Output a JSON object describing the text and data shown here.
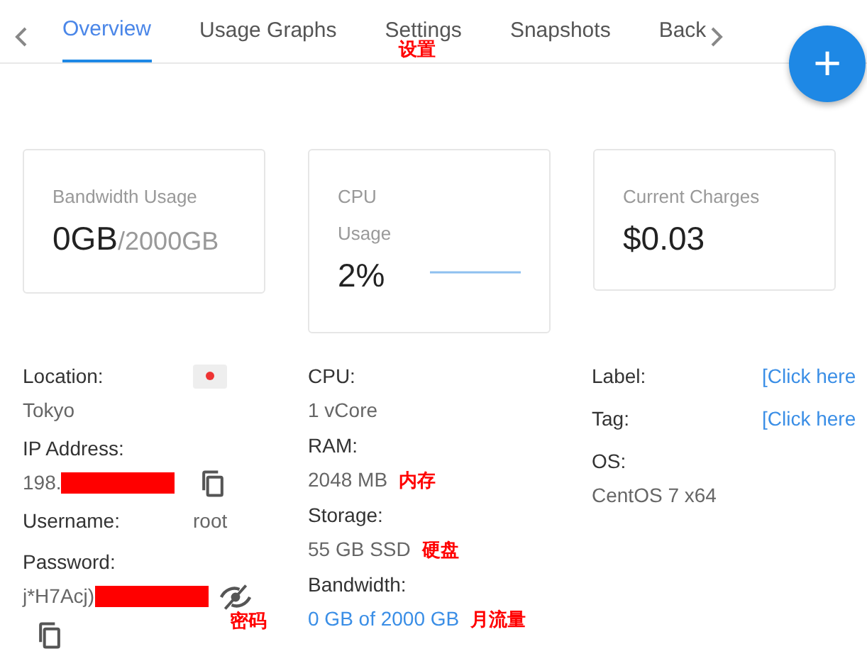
{
  "tabs": [
    {
      "label": "Overview",
      "selected": true
    },
    {
      "label": "Usage Graphs",
      "selected": false
    },
    {
      "label": "Settings",
      "selected": false,
      "note": "设置"
    },
    {
      "label": "Snapshots",
      "selected": false
    },
    {
      "label": "Back",
      "selected": false
    }
  ],
  "fab": "+",
  "cards": [
    {
      "kind": "usage",
      "title": "Bandwidth Usage",
      "value": "0GB",
      "total": "/2000GB"
    },
    {
      "kind": "cpu",
      "title": "CPU",
      "subtitle": "Usage",
      "value": "2%"
    },
    {
      "kind": "money",
      "title": "Current Charges",
      "value": "$0.03"
    }
  ],
  "details": [
    [
      {
        "kind": "stacked",
        "label": "Location:",
        "value": "Tokyo",
        "flag": true
      },
      {
        "kind": "stacked",
        "label": "IP Address:",
        "value": "198.",
        "redacted": true,
        "copy_inline": true
      },
      {
        "kind": "inline",
        "label": "Username:",
        "value": "root"
      },
      {
        "kind": "stacked",
        "label": "Password:",
        "value": "j*H7Acj)",
        "redacted": true,
        "eye": true,
        "note": "密码",
        "copy_below": true
      }
    ],
    [
      {
        "kind": "stacked",
        "label": "CPU:",
        "value": "1 vCore"
      },
      {
        "kind": "stacked",
        "label": "RAM:",
        "value": "2048 MB",
        "note": "内存"
      },
      {
        "kind": "stacked",
        "label": "Storage:",
        "value": "55 GB SSD",
        "note": "硬盘"
      },
      {
        "kind": "link",
        "label": "Bandwidth:",
        "value": "0 GB of 2000 GB",
        "note": "月流量"
      }
    ],
    [
      {
        "kind": "inline-link",
        "label": "Label:",
        "value": "[Click here"
      },
      {
        "kind": "inline-link",
        "label": "Tag:",
        "value": "[Click here"
      },
      {
        "kind": "stacked",
        "label": "OS:",
        "value": "CentOS 7 x64"
      }
    ]
  ]
}
